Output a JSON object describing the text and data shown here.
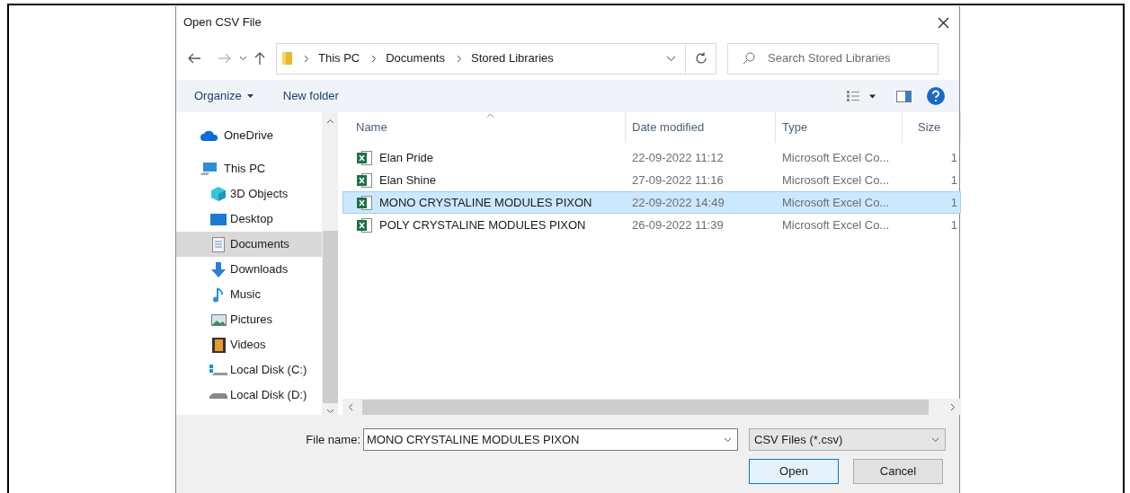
{
  "window": {
    "title": "Open CSV File"
  },
  "address": {
    "crumbs": [
      "This PC",
      "Documents",
      "Stored Libraries"
    ]
  },
  "search": {
    "placeholder": "Search Stored Libraries"
  },
  "toolbar": {
    "organize": "Organize",
    "new_folder": "New folder"
  },
  "nav": [
    {
      "label": "OneDrive",
      "kind": "cloud",
      "selected": false
    },
    {
      "label": "This PC",
      "kind": "pc",
      "selected": false,
      "children": [
        {
          "label": "3D Objects",
          "kind": "cube",
          "selected": false
        },
        {
          "label": "Desktop",
          "kind": "desktop",
          "selected": false
        },
        {
          "label": "Documents",
          "kind": "doc",
          "selected": true
        },
        {
          "label": "Downloads",
          "kind": "download",
          "selected": false
        },
        {
          "label": "Music",
          "kind": "music",
          "selected": false
        },
        {
          "label": "Pictures",
          "kind": "pictures",
          "selected": false
        },
        {
          "label": "Videos",
          "kind": "videos",
          "selected": false
        },
        {
          "label": "Local Disk (C:)",
          "kind": "diskc",
          "selected": false
        },
        {
          "label": "Local Disk (D:)",
          "kind": "disk",
          "selected": false
        }
      ]
    }
  ],
  "table": {
    "columns": [
      "Name",
      "Date modified",
      "Type",
      "Size"
    ],
    "rows": [
      {
        "name": "Elan Pride",
        "date": "22-09-2022 11:12",
        "type": "Microsoft Excel Co...",
        "size": "1",
        "selected": false
      },
      {
        "name": "Elan Shine",
        "date": "27-09-2022 11:16",
        "type": "Microsoft Excel Co...",
        "size": "1",
        "selected": false
      },
      {
        "name": "MONO CRYSTALINE MODULES PIXON",
        "date": "22-09-2022 14:49",
        "type": "Microsoft Excel Co...",
        "size": "1",
        "selected": true
      },
      {
        "name": "POLY CRYSTALINE MODULES PIXON",
        "date": "26-09-2022 11:39",
        "type": "Microsoft Excel Co...",
        "size": "1",
        "selected": false
      }
    ]
  },
  "footer": {
    "file_name_label": "File name:",
    "file_name": "MONO CRYSTALINE MODULES PIXON",
    "filter": "CSV Files (*.csv)",
    "open": "Open",
    "cancel": "Cancel"
  }
}
